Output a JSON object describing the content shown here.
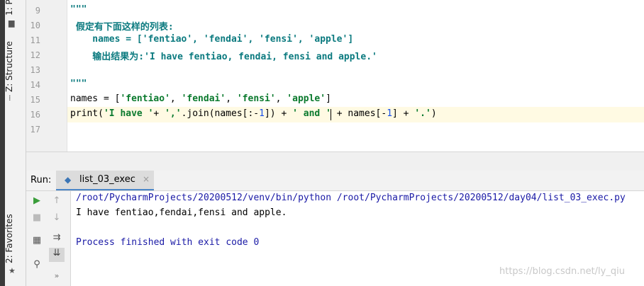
{
  "sidebar": {
    "project_tab": "1: P",
    "structure_tab": "Z: Structure",
    "favorites_tab": "2: Favorites"
  },
  "editor": {
    "lines": [
      {
        "num": "9",
        "text": "\"\"\"",
        "kind": "doc"
      },
      {
        "num": "10",
        "text": " 假定有下面这样的列表:",
        "kind": "doc"
      },
      {
        "num": "11",
        "text": "    names = ['fentiao', 'fendai', 'fensi', 'apple']",
        "kind": "doc"
      },
      {
        "num": "12",
        "text": "    输出结果为:'I have fentiao, fendai, fensi and apple.'",
        "kind": "doc"
      },
      {
        "num": "13",
        "text": "",
        "kind": "doc"
      },
      {
        "num": "14",
        "text": "\"\"\"",
        "kind": "doc"
      },
      {
        "num": "15",
        "text": "names = ['fentiao', 'fendai', 'fensi', 'apple']",
        "kind": "code"
      },
      {
        "num": "16",
        "text": "print('I have '+ ','.join(names[:-1]) + ' and ' + names[-1] + '.')",
        "kind": "code"
      },
      {
        "num": "17",
        "text": "",
        "kind": "code"
      }
    ]
  },
  "run_panel": {
    "label": "Run:",
    "tab_name": "list_03_exec",
    "close_symbol": "×",
    "output": [
      {
        "text": "/root/PycharmProjects/20200512/venv/bin/python /root/PycharmProjects/20200512/day04/list_03_exec.py",
        "color": "#1a1aa6"
      },
      {
        "text": "I have fentiao,fendai,fensi and apple.",
        "color": "#000000"
      },
      {
        "text": "",
        "color": "#000000"
      },
      {
        "text": "Process finished with exit code 0",
        "color": "#1a1aa6"
      }
    ]
  },
  "watermark": "https://blog.csdn.net/ly_qiu"
}
